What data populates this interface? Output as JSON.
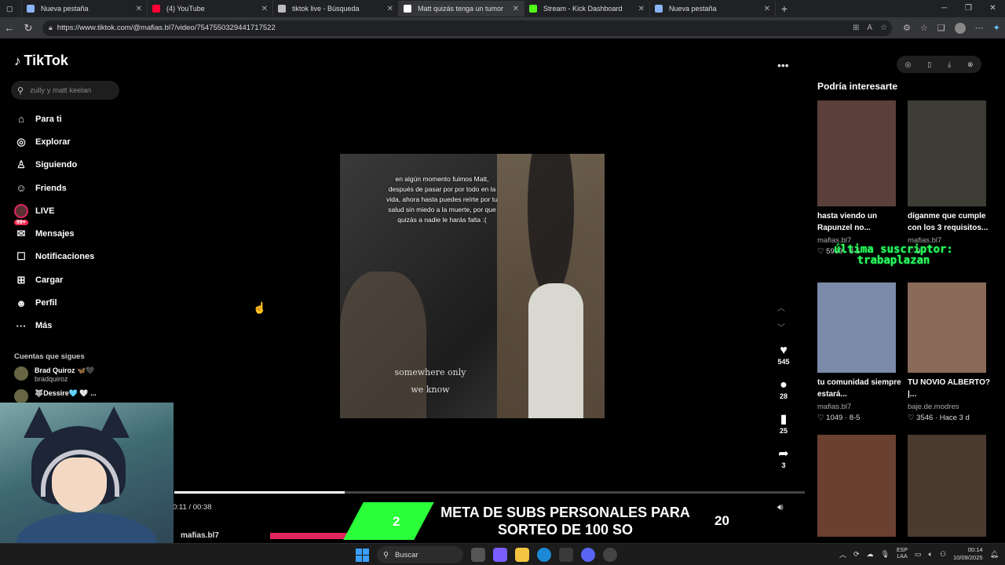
{
  "browser": {
    "tabs": [
      {
        "title": "Nueva pestaña",
        "color": "#8ab4f8",
        "active": false
      },
      {
        "title": "(4) YouTube",
        "color": "#ff0033",
        "active": false
      },
      {
        "title": "tiktok live - Búsqueda",
        "color": "#bbbbbb",
        "active": false
      },
      {
        "title": "Matt quizás tenga un tumor",
        "color": "#ffffff",
        "active": true
      },
      {
        "title": "Stream - Kick Dashboard",
        "color": "#53fc18",
        "active": false
      },
      {
        "title": "Nueva pestaña",
        "color": "#8ab4f8",
        "active": false
      }
    ],
    "url": "https://www.tiktok.com/@mafias.bl7/video/7547550329441717522"
  },
  "sidebar": {
    "logo": "TikTok",
    "search_placeholder": "zully y matt keelan",
    "nav": [
      {
        "icon": "home-icon",
        "glyph": "⌂",
        "label": "Para ti"
      },
      {
        "icon": "compass-icon",
        "glyph": "◎",
        "label": "Explorar"
      },
      {
        "icon": "following-icon",
        "glyph": "♙",
        "label": "Siguiendo"
      },
      {
        "icon": "friends-icon",
        "glyph": "☺",
        "label": "Friends"
      },
      {
        "icon": "live-icon",
        "glyph": "",
        "label": "LIVE"
      },
      {
        "icon": "messages-icon",
        "glyph": "✉",
        "label": "Mensajes",
        "badge": "99+"
      },
      {
        "icon": "notifications-icon",
        "glyph": "☐",
        "label": "Notificaciones"
      },
      {
        "icon": "upload-icon",
        "glyph": "⊞",
        "label": "Cargar"
      },
      {
        "icon": "profile-icon",
        "glyph": "☻",
        "label": "Perfil"
      },
      {
        "icon": "more-icon",
        "glyph": "···",
        "label": "Más"
      }
    ],
    "following_title": "Cuentas que sigues",
    "following": [
      {
        "name": "Brad Quiroz 🦋🖤",
        "handle": "bradquiroz"
      },
      {
        "name": "🐺Dessire🩵 🤍 ...",
        "handle": ""
      }
    ]
  },
  "video": {
    "caption": "en algún momento fuimos Matt, después de pasar por por todo en la vida, ahora hasta puedes reírte por tu salud sin miedo a la muerte, por que quizás a nadie le harás falta :(",
    "lyric": "somewhere only we know",
    "likes": "545",
    "comments": "28",
    "saves": "25",
    "shares": "3",
    "time": "0:11 / 00:38",
    "progress": 0.27,
    "author": "mafias.bl7"
  },
  "recommendations": {
    "title": "Podría interesarte",
    "items": [
      {
        "text": "hasta viendo un Rapunzel no...",
        "user": "mafias.bl7",
        "stats": "♡ 5909 · 8-5",
        "thumb": "#5a3f3a"
      },
      {
        "text": "díganme que cumple con los 3 requisitos...",
        "user": "mafias.bl7",
        "stats": "♡ 9",
        "thumb": "#3d3d36"
      },
      {
        "text": "tu comunidad siempre estará...",
        "user": "mafias.bl7",
        "stats": "♡ 1049 · 8-5",
        "thumb": "#7a8aa8"
      },
      {
        "text": "TU NOVIO ALBERTO? |...",
        "user": "baje.de.modres",
        "stats": "♡ 3546 · Hace 3 d",
        "thumb": "#8a6a58"
      },
      {
        "text": "",
        "user": "",
        "stats": "",
        "thumb": "#6a4030"
      },
      {
        "text": "",
        "user": "",
        "stats": "",
        "thumb": "#4a3a30"
      }
    ]
  },
  "overlay": {
    "last_sub": "última suscriptor: trabaplazan",
    "goal_text": "META DE SUBS PERSONALES PARA SORTEO DE 100 SO",
    "goal_current": "2",
    "goal_target": "20"
  },
  "taskbar": {
    "search": "Buscar",
    "lang": "ESP\nLAA",
    "time": "00:14",
    "date": "10/09/2025"
  }
}
